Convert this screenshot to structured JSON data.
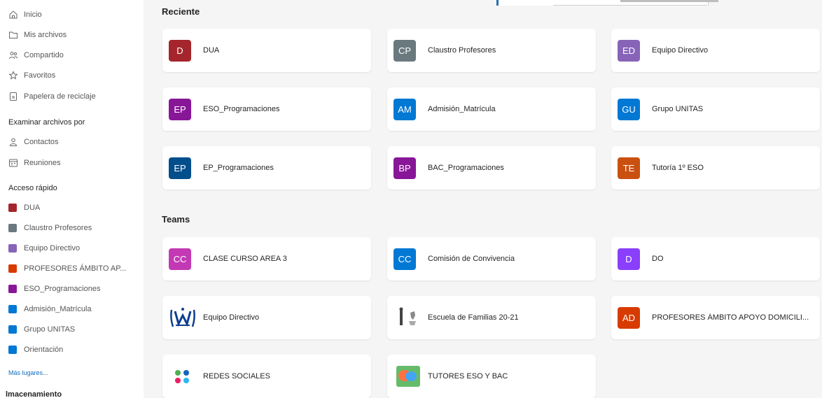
{
  "sidebar": {
    "nav": [
      {
        "label": "Inicio",
        "icon": "home-icon"
      },
      {
        "label": "Mis archivos",
        "icon": "folder-icon"
      },
      {
        "label": "Compartido",
        "icon": "people-icon"
      },
      {
        "label": "Favoritos",
        "icon": "star-icon"
      },
      {
        "label": "Papelera de reciclaje",
        "icon": "recycle-bin-icon"
      }
    ],
    "browse_label": "Examinar archivos por",
    "browse": [
      {
        "label": "Contactos",
        "icon": "person-icon"
      },
      {
        "label": "Reuniones",
        "icon": "calendar-icon"
      }
    ],
    "quick_label": "Acceso rápido",
    "quick": [
      {
        "label": "DUA",
        "color": "#a4262c"
      },
      {
        "label": "Claustro Profesores",
        "color": "#69797e"
      },
      {
        "label": "Equipo Directivo",
        "color": "#8764b8"
      },
      {
        "label": "PROFESORES ÁMBITO AP...",
        "color": "#d83b01"
      },
      {
        "label": "ESO_Programaciones",
        "color": "#881798"
      },
      {
        "label": "Admisión_Matrícula",
        "color": "#0078d4"
      },
      {
        "label": "Grupo UNITAS",
        "color": "#0078d4"
      },
      {
        "label": "Orientación",
        "color": "#0078d4"
      }
    ],
    "more_label": "Más lugares...",
    "storage_label": "lmacenamiento"
  },
  "recent": {
    "title": "Reciente",
    "items": [
      {
        "initials": "D",
        "name": "DUA",
        "color": "#a4262c"
      },
      {
        "initials": "CP",
        "name": "Claustro Profesores",
        "color": "#69797e"
      },
      {
        "initials": "ED",
        "name": "Equipo Directivo",
        "color": "#8764b8"
      },
      {
        "initials": "EP",
        "name": "ESO_Programaciones",
        "color": "#881798"
      },
      {
        "initials": "AM",
        "name": "Admisión_Matrícula",
        "color": "#0078d4"
      },
      {
        "initials": "GU",
        "name": "Grupo UNITAS",
        "color": "#0078d4"
      },
      {
        "initials": "EP",
        "name": "EP_Programaciones",
        "color": "#004e8c"
      },
      {
        "initials": "BP",
        "name": "BAC_Programaciones",
        "color": "#881798"
      },
      {
        "initials": "TE",
        "name": "Tutoría 1º ESO",
        "color": "#ca5010"
      }
    ]
  },
  "teams": {
    "title": "Teams",
    "items": [
      {
        "initials": "CC",
        "name": "CLASE CURSO AREA 3",
        "color": "#c239b3"
      },
      {
        "initials": "CC",
        "name": "Comisión de Convivencia",
        "color": "#0078d4"
      },
      {
        "initials": "D",
        "name": "DO",
        "color": "#8a3ffc"
      },
      {
        "logo": "equipo-directivo-logo",
        "name": "Equipo Directivo"
      },
      {
        "logo": "escuela-familias-logo",
        "name": "Escuela de Familias 20-21"
      },
      {
        "initials": "AD",
        "name": "PROFESORES ÁMBITO APOYO DOMICILI...",
        "color": "#d83b01"
      },
      {
        "logo": "redes-sociales-logo",
        "name": "REDES SOCIALES"
      },
      {
        "logo": "tutores-logo",
        "name": "TUTORES ESO Y BAC"
      }
    ]
  }
}
